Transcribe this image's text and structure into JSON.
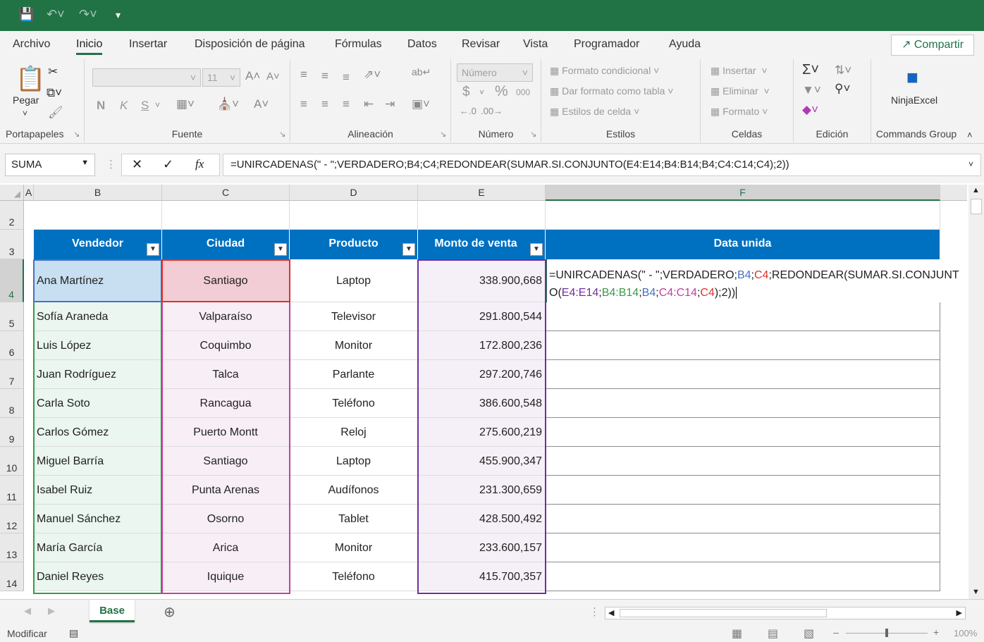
{
  "tabs": [
    "Archivo",
    "Inicio",
    "Insertar",
    "Disposición de página",
    "Fórmulas",
    "Datos",
    "Revisar",
    "Vista",
    "Programador",
    "Ayuda"
  ],
  "share_label": "Compartir",
  "ribbon": {
    "paste_label": "Pegar",
    "group_clipboard": "Portapapeles",
    "group_font": "Fuente",
    "font_size": "11",
    "bold": "N",
    "italic": "K",
    "underline": "S",
    "group_align": "Alineación",
    "number_format": "Número",
    "currency": "$",
    "percent": "%",
    "thousands": "000",
    "group_number": "Número",
    "cond_format": "Formato condicional",
    "table_format": "Dar formato como tabla",
    "cell_styles": "Estilos de celda",
    "group_styles": "Estilos",
    "insert": "Insertar",
    "delete": "Eliminar",
    "format": "Formato",
    "group_cells": "Celdas",
    "group_edit": "Edición",
    "addin_name": "NinjaExcel",
    "group_commands": "Commands Group"
  },
  "namebox": "SUMA",
  "formula": "=UNIRCADENAS(\" - \";VERDADERO;B4;C4;REDONDEAR(SUMAR.SI.CONJUNTO(E4:E14;B4:B14;B4;C4:C14;C4);2))",
  "columns": [
    "A",
    "B",
    "C",
    "D",
    "E",
    "F"
  ],
  "rows": [
    "2",
    "3",
    "4",
    "5",
    "6",
    "7",
    "8",
    "9",
    "10",
    "11",
    "12",
    "13",
    "14"
  ],
  "headers": [
    "Vendedor",
    "Ciudad",
    "Producto",
    "Monto de venta",
    "Data unida"
  ],
  "table": [
    [
      "Ana Martínez",
      "Santiago",
      "Laptop",
      "338.900,668"
    ],
    [
      "Sofía Araneda",
      "Valparaíso",
      "Televisor",
      "291.800,544"
    ],
    [
      "Luis López",
      "Coquimbo",
      "Monitor",
      "172.800,236"
    ],
    [
      "Juan Rodríguez",
      "Talca",
      "Parlante",
      "297.200,746"
    ],
    [
      "Carla Soto",
      "Rancagua",
      "Teléfono",
      "386.600,548"
    ],
    [
      "Carlos Gómez",
      "Puerto Montt",
      "Reloj",
      "275.600,219"
    ],
    [
      "Miguel Barría",
      "Santiago",
      "Laptop",
      "455.900,347"
    ],
    [
      "Isabel Ruiz",
      "Punta Arenas",
      "Audífonos",
      "231.300,659"
    ],
    [
      "Manuel Sánchez",
      "Osorno",
      "Tablet",
      "428.500,492"
    ],
    [
      "María García",
      "Arica",
      "Monitor",
      "233.600,157"
    ],
    [
      "Daniel Reyes",
      "Iquique",
      "Teléfono",
      "415.700,357"
    ]
  ],
  "edit_formula": {
    "p1": "=UNIRCADENAS(\" - \";VERDADERO;",
    "b4": "B4",
    "s1": ";",
    "c4": "C4",
    "p2": ";REDONDEAR(SUMAR.SI.CONJUNTO(",
    "e": "E4:E14",
    "s2": ";",
    "b": "B4:B14",
    "s3": ";",
    "b4b": "B4",
    "s4": ";",
    "c": "C4:C14",
    "s5": ";",
    "c4b": "C4",
    "p3": ");2))"
  },
  "sheet_tab": "Base",
  "status": {
    "mode": "Modificar",
    "zoom": "100%"
  },
  "colors": {
    "excel_green": "#217346",
    "header_blue": "#0070c0",
    "ref_blue": "#4472c4",
    "ref_red": "#e0302c",
    "ref_purple": "#7030a0",
    "ref_green": "#3a9a48",
    "ref_pink": "#c040a0"
  }
}
